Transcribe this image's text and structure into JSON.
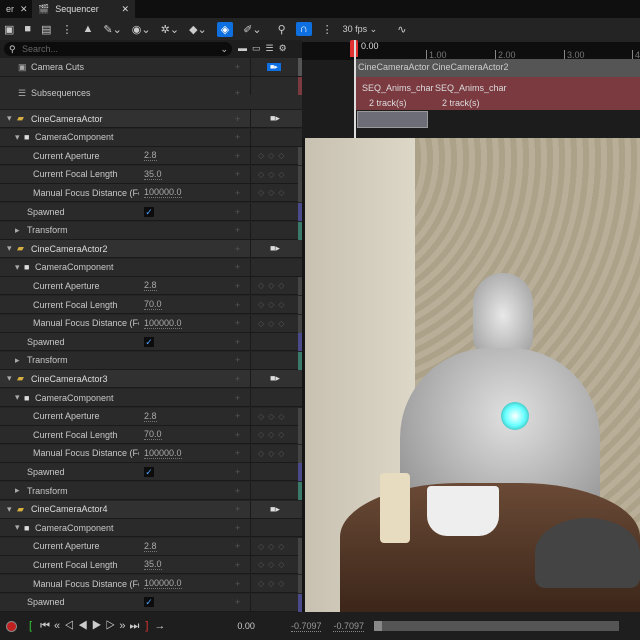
{
  "tabs": [
    {
      "label": "er"
    },
    {
      "label": "Sequencer"
    }
  ],
  "toolbar": {
    "fps": "30 fps"
  },
  "search": {
    "placeholder": "Search..."
  },
  "tracks": [
    {
      "label": "Camera Cuts"
    },
    {
      "label": "Subsequences"
    }
  ],
  "actors": [
    {
      "name": "CineCameraActor",
      "aperture": "2.8",
      "focal": "35.0",
      "focus": "100000.0"
    },
    {
      "name": "CineCameraActor2",
      "aperture": "2.8",
      "focal": "70.0",
      "focus": "100000.0"
    },
    {
      "name": "CineCameraActor3",
      "aperture": "2.8",
      "focal": "70.0",
      "focus": "100000.0"
    },
    {
      "name": "CineCameraActor4",
      "aperture": "2.8",
      "focal": "35.0",
      "focus": "100000.0"
    }
  ],
  "labels": {
    "component": "CameraComponent",
    "aperture": "Current Aperture",
    "focal": "Current Focal Length",
    "focus": "Manual Focus Distance (Focu",
    "spawned": "Spawned",
    "transform": "Transform"
  },
  "timeline": {
    "playhead": "0.00",
    "ticks": [
      "1.00",
      "2.00",
      "3.00",
      "4.0"
    ],
    "cuts": [
      "CineCameraActor",
      "CineCameraActor2"
    ],
    "subseq": [
      {
        "name": "SEQ_Anims_char",
        "tracks": "2 track(s)"
      },
      {
        "name": "SEQ_Anims_char",
        "tracks": "2 track(s)"
      }
    ]
  },
  "bottom": {
    "time": "0.00",
    "range_start": "-0.7097",
    "range_end": "-0.7097"
  },
  "colors": {
    "accent": "#0e70e0",
    "subseq": "#7a3a40",
    "playhead": "#e03030"
  }
}
